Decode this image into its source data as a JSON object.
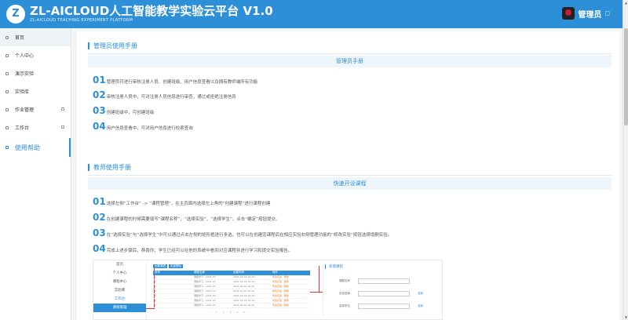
{
  "header": {
    "logo_char": "Z",
    "title": "ZL-AICLOUD人工智能教学实验云平台 V1.0",
    "subtitle": "ZL-AICLOUD TEACHING EXPERIMENT PLATFORM",
    "user_name": "管理员",
    "dropdown_glyph": "▢",
    "bg_color": "#2e8fd9"
  },
  "sidebar": {
    "items": [
      {
        "label": "首页"
      },
      {
        "label": "个人中心"
      },
      {
        "label": "演示实验"
      },
      {
        "label": "实验库"
      },
      {
        "label": "作业管理"
      },
      {
        "label": "工作台"
      },
      {
        "label": "使用帮助"
      }
    ]
  },
  "admin_section": {
    "title": "管理员使用手册",
    "banner": "管理员手册",
    "steps": [
      {
        "num": "01",
        "text": "管理员可进行审核注册人员、创建班级、用户信息查看以及拥有教师端所有功能"
      },
      {
        "num": "02",
        "text": "审核注册人员中，可对注册人员信息进行审查，通过或拒绝注册信息"
      },
      {
        "num": "03",
        "text": "创建班级中，可创建班级"
      },
      {
        "num": "04",
        "text": "用户信息查看中，可对用户信息进行检索查询"
      }
    ]
  },
  "teacher_section": {
    "title": "教师使用手册",
    "banner": "快速开设课程",
    "steps": [
      {
        "num": "01",
        "text": "选择左侧“工作台” -> “课程管理”，在主页面内选择左上角的“创建课程”进行课程创建"
      },
      {
        "num": "02",
        "text": "在创建课程的时候需要填写“课程名称”，“选择实验”，“选择学生”，点击“确定”按钮提交。"
      },
      {
        "num": "03",
        "text": "在“选择实验”与“选择学生”中可以通过点击左侧的矩形框进行多选，也可以在创建完课程后在相应实验右侧管理功能的“修改实验”按钮选择增删实验。"
      },
      {
        "num": "04",
        "text": "完成上述步骤后，恭喜你，学生已经可以在他的系统中看到对应课程并进行学习和提交实验报告。"
      }
    ]
  },
  "illustration": {
    "side_items": [
      "首页",
      "个人中心",
      "课程中心",
      "实验库",
      "工作台",
      "课程管理"
    ],
    "tabs": [
      "创建课程",
      "批量删除"
    ],
    "headers": [
      "序号",
      "课程名称",
      "创建时间",
      "操作"
    ],
    "rows": [
      [
        "1",
        "课程学习 - 2021-XX",
        "2021-01-16 10:24",
        "修改实验 · 删除"
      ],
      [
        "2",
        "课程学习 - 2021-XX",
        "2021-01-16 10:24",
        "修改实验 · 删除"
      ],
      [
        "3",
        "课程学习 - 2021-XX",
        "2021-01-16 10:24",
        "修改实验 · 删除"
      ],
      [
        "4",
        "课程学习 - 2021-XX",
        "2021-01-16 10:24",
        "修改实验 · 删除"
      ],
      [
        "5",
        "课程学习 - 2021-XX",
        "2021-01-16 10:24",
        "修改实验 · 删除"
      ],
      [
        "6",
        "课程学习 - 2021-XX",
        "2021-01-16 10:24",
        "修改实验 · 删除"
      ],
      [
        "7",
        "课程学习 - 2021-XX",
        "2021-01-16 10:24",
        "修改实验 · 删除"
      ]
    ],
    "pager": "‹ 1 2 3 4 5 ›",
    "form_title": "新增课程",
    "fields": [
      {
        "label": "课程名称",
        "pick": ""
      },
      {
        "label": "实验选择",
        "pick": "选择"
      },
      {
        "label": "选择学生",
        "pick": "选择"
      }
    ]
  }
}
